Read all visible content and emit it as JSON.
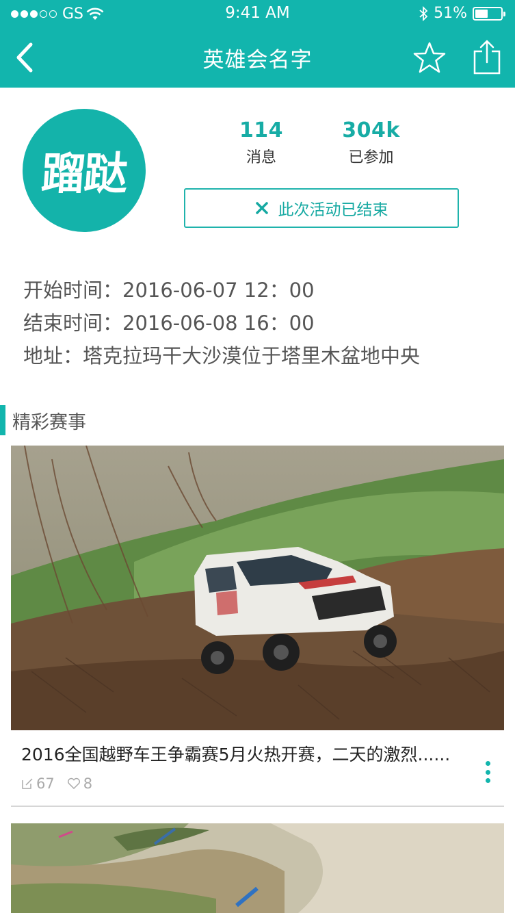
{
  "status_bar": {
    "carrier": "GS",
    "time": "9:41 AM",
    "battery": "51%",
    "battery_level": 0.51,
    "signal_bars_filled": 3,
    "signal_bars_total": 5
  },
  "navbar": {
    "title": "英雄会名字",
    "back_icon": "chevron-left-icon",
    "favorite_icon": "star-outline-icon",
    "share_icon": "share-icon"
  },
  "profile": {
    "avatar_text": "蹓跶",
    "stats": [
      {
        "value": "114",
        "label": "消息"
      },
      {
        "value": "304k",
        "label": "已参加"
      }
    ],
    "status_button": {
      "icon": "close-icon",
      "label": "此次活动已结束"
    }
  },
  "event_info": {
    "start": "开始时间：2016-06-07  12：00",
    "end": "结束时间：2016-06-08  16：00",
    "address": "地址：塔克拉玛干大沙漠位于塔里木盆地中央"
  },
  "section": {
    "title": "精彩赛事"
  },
  "posts": [
    {
      "title": "2016全国越野车王争霸赛5月火热开赛，二天的激烈......",
      "edits": "67",
      "likes": "8",
      "image": "offroad-jeep-photo"
    },
    {
      "image": "offroad-race-photo"
    }
  ],
  "colors": {
    "accent": "#12b5ad",
    "stat_number": "#17aca5",
    "text_dark": "#222222",
    "text_muted": "#aaaaaa"
  }
}
